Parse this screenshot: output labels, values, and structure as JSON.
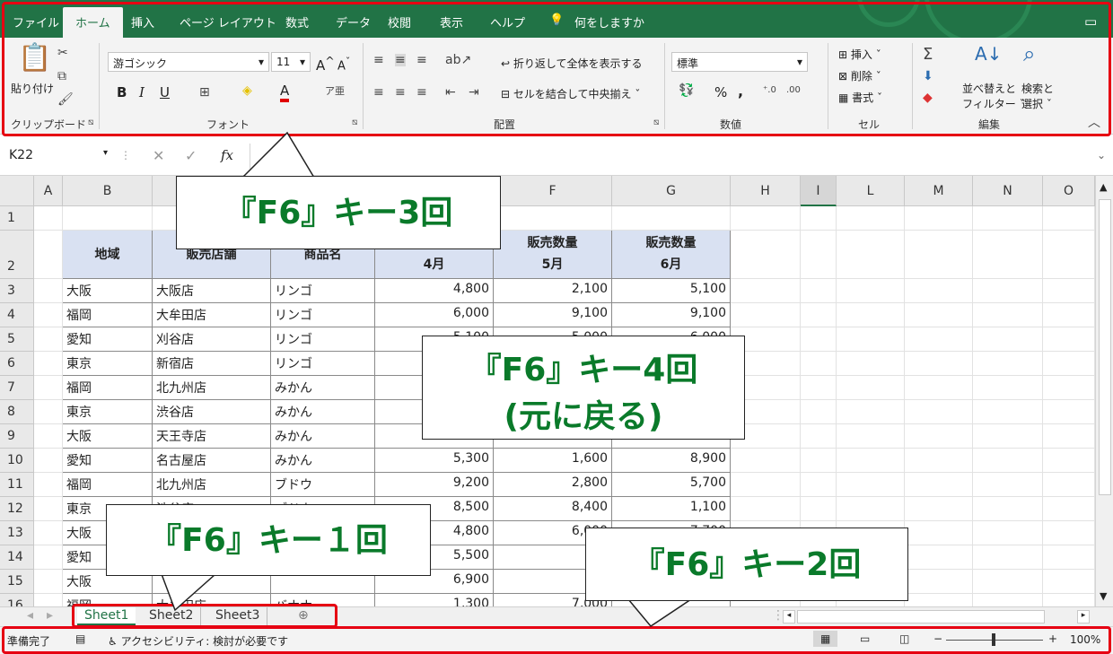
{
  "tabs": [
    "ファイル",
    "ホーム",
    "挿入",
    "ページ レイアウト",
    "数式",
    "データ",
    "校閲",
    "表示",
    "ヘルプ",
    "何をしますか"
  ],
  "ribbon": {
    "paste": "貼り付け",
    "font_name": "游ゴシック",
    "font_size": "11",
    "bold": "B",
    "italic": "I",
    "underline": "U",
    "wrap": "折り返して全体を表示する",
    "merge": "セルを結合して中央揃え",
    "numfmt": "標準",
    "percent": "%",
    "comma": ",",
    "insert": "挿入",
    "delete": "削除",
    "format": "書式",
    "sort": "並べ替えと",
    "sort2": "フィルター",
    "find": "検索と",
    "find2": "選択",
    "groups": [
      "クリップボード",
      "フォント",
      "配置",
      "数値",
      "セル",
      "編集"
    ]
  },
  "namebox": "K22",
  "fx": "fx",
  "columns": [
    "A",
    "B",
    "C",
    "D",
    "E",
    "F",
    "G",
    "H",
    "I",
    "L",
    "M",
    "N",
    "O"
  ],
  "rows": [
    "1",
    "2",
    "3",
    "4",
    "5",
    "6",
    "7",
    "8",
    "9",
    "10",
    "11",
    "12",
    "13",
    "14",
    "15",
    "16"
  ],
  "table": {
    "headers": [
      "地域",
      "販売店舗",
      "商品名",
      "販売数量",
      "販売数量",
      "販売数量"
    ],
    "months": [
      "4月",
      "5月",
      "6月"
    ],
    "data": [
      [
        "大阪",
        "大阪店",
        "リンゴ",
        "4,800",
        "2,100",
        "5,100"
      ],
      [
        "福岡",
        "大牟田店",
        "リンゴ",
        "6,000",
        "9,100",
        "9,100"
      ],
      [
        "愛知",
        "刈谷店",
        "リンゴ",
        "5,100",
        "5,000",
        "6,000"
      ],
      [
        "東京",
        "新宿店",
        "リンゴ",
        "",
        "",
        ""
      ],
      [
        "福岡",
        "北九州店",
        "みかん",
        "",
        "",
        ""
      ],
      [
        "東京",
        "渋谷店",
        "みかん",
        "",
        "",
        ""
      ],
      [
        "大阪",
        "天王寺店",
        "みかん",
        "",
        "",
        ""
      ],
      [
        "愛知",
        "名古屋店",
        "みかん",
        "5,300",
        "1,600",
        "8,900"
      ],
      [
        "福岡",
        "北九州店",
        "ブドウ",
        "9,200",
        "2,800",
        "5,700"
      ],
      [
        "東京",
        "渋谷店",
        "ブドウ",
        "8,500",
        "8,400",
        "1,100"
      ],
      [
        "大阪",
        "",
        "",
        "4,800",
        "6,000",
        "7,700"
      ],
      [
        "愛知",
        "",
        "",
        "5,500",
        "1,",
        "7,"
      ],
      [
        "大阪",
        "",
        "",
        "6,900",
        "7,",
        ""
      ],
      [
        "福岡",
        "大牟田店",
        "バナナ",
        "1,300",
        "7,000",
        ""
      ]
    ]
  },
  "sheets": [
    "Sheet1",
    "Sheet2",
    "Sheet3"
  ],
  "status": {
    "ready": "準備完了",
    "accessibility": "アクセシビリティ: 検討が必要です",
    "zoom": "100%"
  },
  "callouts": {
    "c3": "『F6』キー3回",
    "c4a": "『F6』キー4回",
    "c4b": "(元に戻る)",
    "c1": "『F6』キー１回",
    "c2": "『F6』キー2回"
  }
}
